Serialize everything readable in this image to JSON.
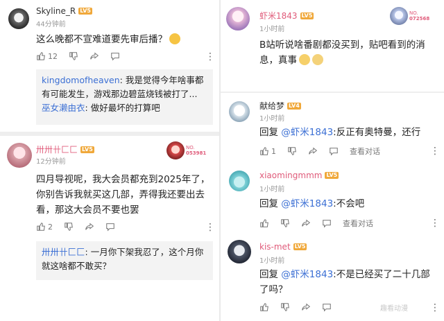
{
  "left": {
    "c1": {
      "user": "Skyline_R",
      "level": "LV5",
      "time": "44分钟前",
      "text": "这么晚都不宣难道要先审后播？",
      "likes": "12",
      "reply": {
        "r1_name": "kingdomofheaven",
        "r1_text": "我是觉得今年啥事都有可能发生，游戏那边碧蓝烧钱被打了...",
        "r2_name": "巫女濑由衣",
        "r2_text": "做好最坏的打算吧"
      }
    },
    "c2": {
      "user": "卅卅卄匚匚",
      "level": "LV5",
      "time": "12分钟前",
      "text": "四月导视呢，我大会员都充到2025年了，你别告诉我就买这几部，弄得我还要出去看，那这大会员不要也罢",
      "likes": "2",
      "medal": {
        "no": "NO.",
        "num": "053981"
      },
      "reply": {
        "r1_name": "卅卅卄匚匚",
        "r1_text": "一月你下架我忍了，这个月你就这啥都不敢买？"
      }
    }
  },
  "right": {
    "c1": {
      "user": "虾米1843",
      "level": "LV5",
      "time": "1小时前",
      "text": "B站听说啥番剧都没买到，贴吧看到的消息，真事",
      "medal": {
        "no": "NO.",
        "num": "072568"
      }
    },
    "c2": {
      "user": "献给梦",
      "level": "LV4",
      "time": "1小时前",
      "prefix": "回复",
      "at": "@虾米1843",
      "text": ":反正有奥特曼，还行",
      "likes": "1",
      "view": "查看对话"
    },
    "c3": {
      "user": "xiaomingmmm",
      "level": "LV5",
      "time": "1小时前",
      "prefix": "回复",
      "at": "@虾米1843",
      "text": ":不会吧",
      "view": "查看对话"
    },
    "c4": {
      "user": "kis-met",
      "level": "LV5",
      "time": "1小时前",
      "prefix": "回复",
      "at": "@虾米1843",
      "text": ":不是已经买了二十几部了吗？"
    },
    "watermark": "趣看动漫"
  },
  "colors": {
    "accent": "#e05b7a",
    "link": "#3b6fd4",
    "level": "#f0a83a"
  }
}
